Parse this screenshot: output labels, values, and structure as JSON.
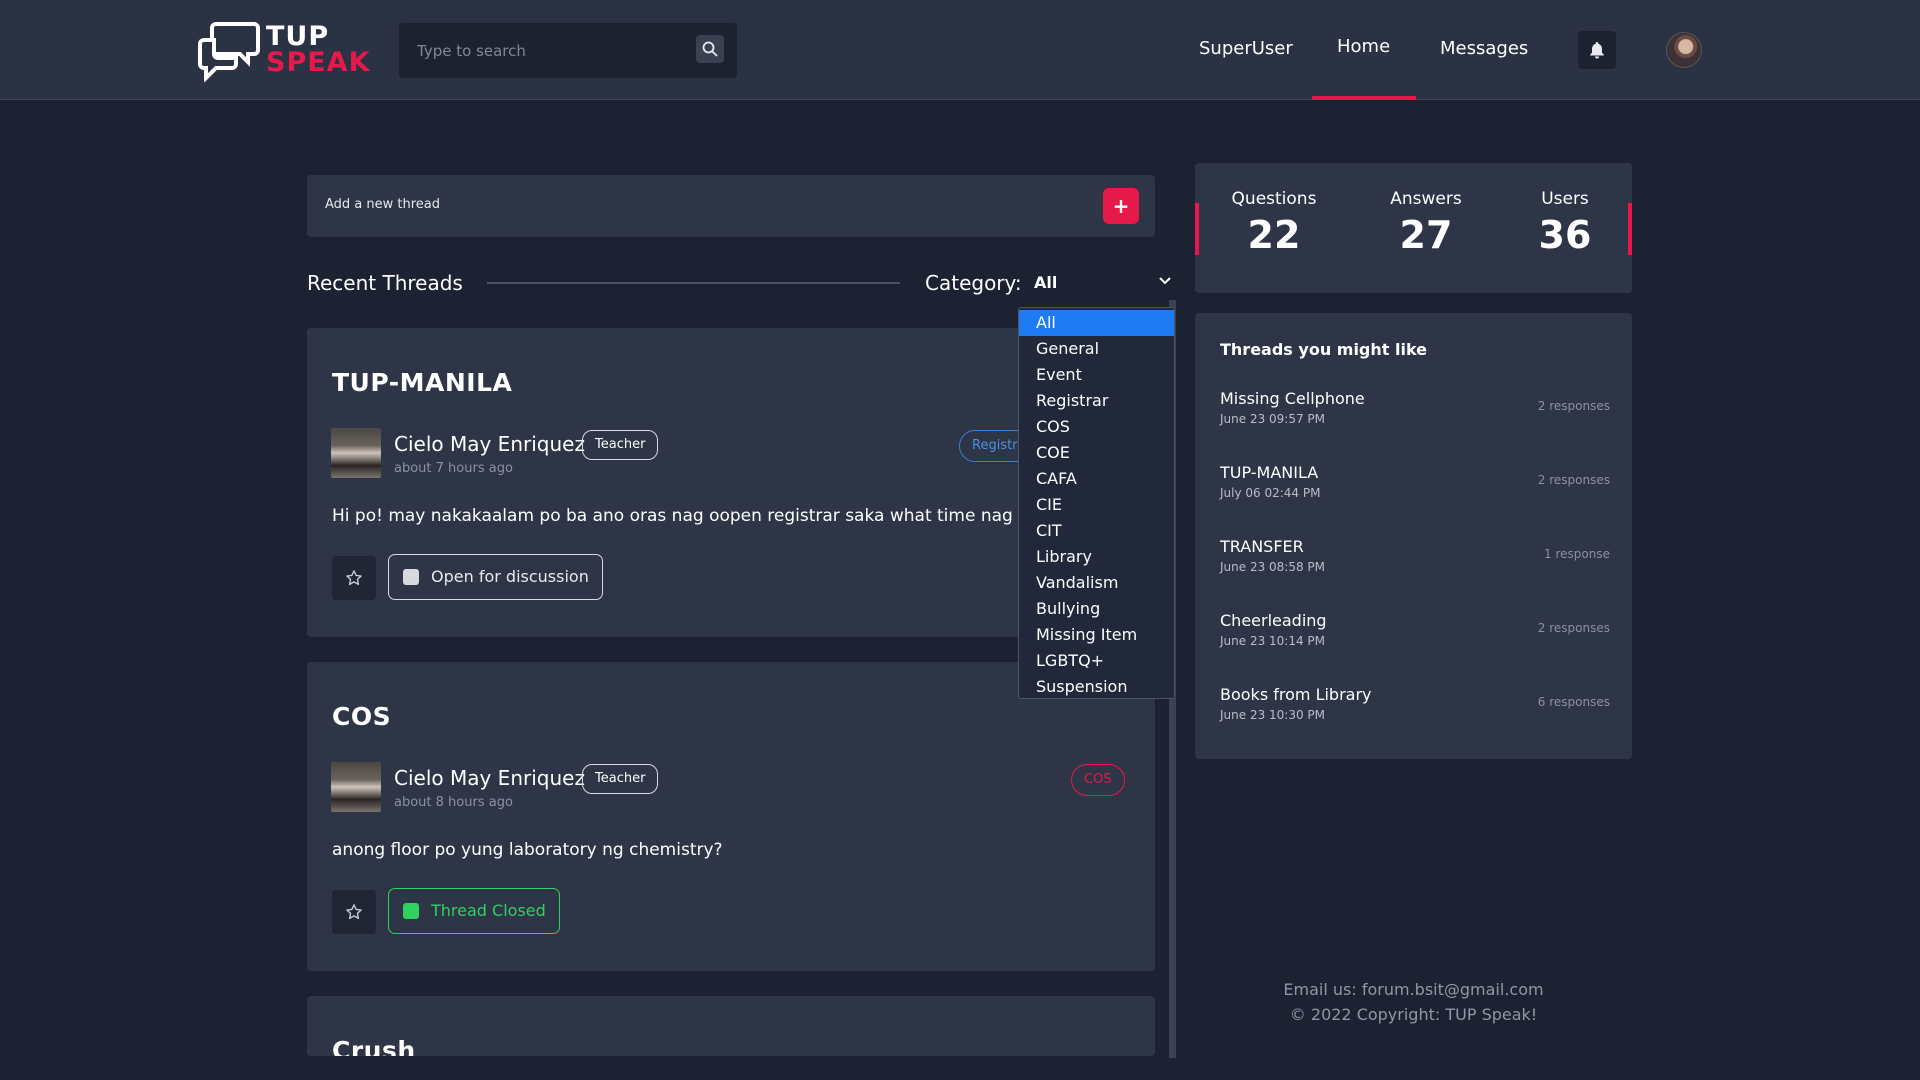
{
  "header": {
    "logo_top": "TUP",
    "logo_bottom": "SPEAK",
    "search_placeholder": "Type to search",
    "nav": {
      "superuser": "SuperUser",
      "home": "Home",
      "messages": "Messages"
    }
  },
  "add_thread": {
    "label": "Add a new thread",
    "button": "+"
  },
  "recent": {
    "title": "Recent Threads",
    "category_label": "Category:",
    "category_value": "All"
  },
  "dropdown": {
    "options": [
      "All",
      "General",
      "Event",
      "Registrar",
      "COS",
      "COE",
      "CAFA",
      "CIE",
      "CIT",
      "Library",
      "Vandalism",
      "Bullying",
      "Missing Item",
      "LGBTQ+",
      "Suspension"
    ],
    "selected": "All"
  },
  "threads": [
    {
      "title": "TUP-MANILA",
      "author": "Cielo May Enriquez",
      "role": "Teacher",
      "time": "about 7 hours ago",
      "category": "Registrar",
      "body": "Hi po! may nakakaalam po ba ano oras nag oopen registrar saka what time nag close",
      "status": "Open for discussion"
    },
    {
      "title": "COS",
      "author": "Cielo May Enriquez",
      "role": "Teacher",
      "time": "about 8 hours ago",
      "category": "COS",
      "body": "anong floor po yung laboratory ng chemistry?",
      "status": "Thread Closed"
    },
    {
      "title": "Crush"
    }
  ],
  "stats": {
    "questions_label": "Questions",
    "questions_value": "22",
    "answers_label": "Answers",
    "answers_value": "27",
    "users_label": "Users",
    "users_value": "36"
  },
  "likes": {
    "title": "Threads you might like",
    "items": [
      {
        "title": "Missing Cellphone",
        "date": "June 23 09:57 PM",
        "responses": "2 responses"
      },
      {
        "title": "TUP-MANILA",
        "date": "July 06 02:44 PM",
        "responses": "2 responses"
      },
      {
        "title": "TRANSFER",
        "date": "June 23 08:58 PM",
        "responses": "1 response"
      },
      {
        "title": "Cheerleading",
        "date": "June 23 10:14 PM",
        "responses": "2 responses"
      },
      {
        "title": "Books from Library",
        "date": "June 23 10:30 PM",
        "responses": "6 responses"
      }
    ]
  },
  "footer": {
    "email": "Email us: forum.bsit@gmail.com",
    "copyright": "© 2022 Copyright: TUP Speak!"
  },
  "colors": {
    "accent": "#e5194a",
    "background": "#1c2231",
    "card": "#2e3546",
    "header": "#2b3243",
    "selected": "#1e7bf2",
    "closed_green": "#2fd160"
  },
  "icons": {
    "search": "search-icon",
    "bell": "bell-icon",
    "star": "star-icon",
    "chevron": "chevron-down-icon"
  }
}
